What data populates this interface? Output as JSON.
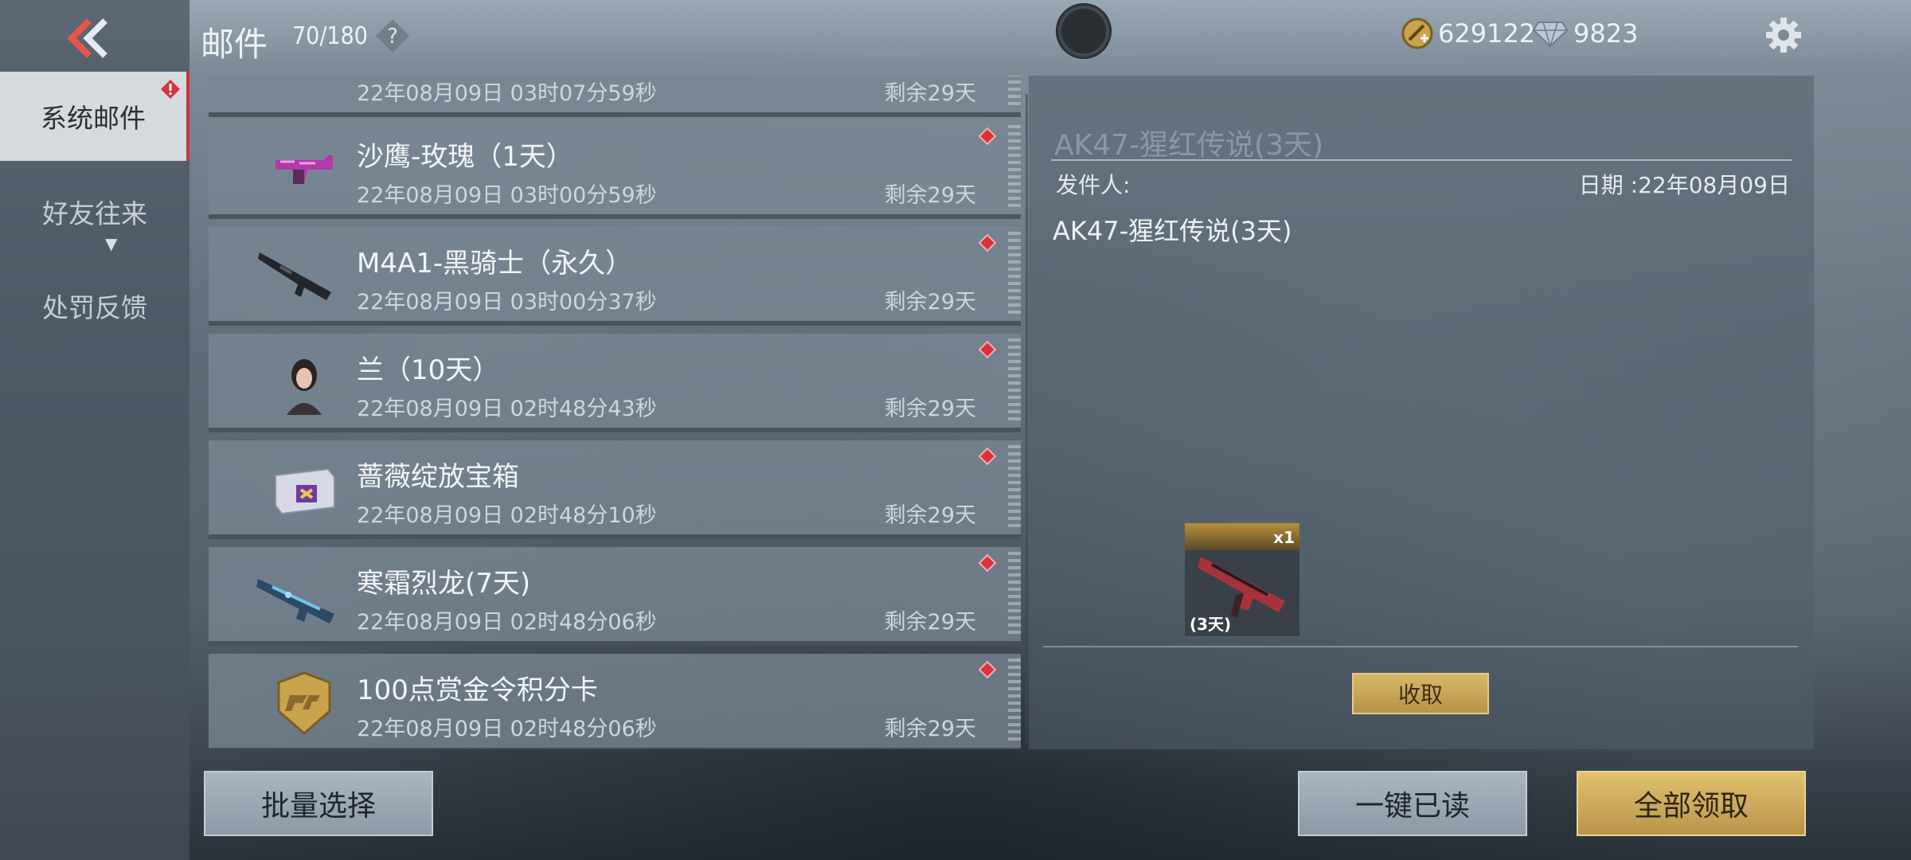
{
  "header": {
    "title": "邮件",
    "mail_count": "70/180",
    "help_symbol": "?",
    "gold": "629122",
    "diamonds": "9823"
  },
  "sidebar": {
    "items": [
      {
        "label": "系统邮件",
        "active": true
      },
      {
        "label": "好友往来",
        "active": false
      },
      {
        "label": "处罚反馈",
        "active": false
      }
    ]
  },
  "mails": [
    {
      "title": "",
      "time": "22年08月09日 03时07分59秒",
      "remaining": "剩余29天",
      "icon": "partial-top"
    },
    {
      "title": "沙鹰-玫瑰（1天）",
      "time": "22年08月09日 03时00分59秒",
      "remaining": "剩余29天",
      "icon": "pistol-icon"
    },
    {
      "title": "M4A1-黑骑士（永久）",
      "time": "22年08月09日 03时00分37秒",
      "remaining": "剩余29天",
      "icon": "rifle-icon"
    },
    {
      "title": "兰（10天）",
      "time": "22年08月09日 02时48分43秒",
      "remaining": "剩余29天",
      "icon": "character-icon"
    },
    {
      "title": "蔷薇绽放宝箱",
      "time": "22年08月09日 02时48分10秒",
      "remaining": "剩余29天",
      "icon": "chest-icon"
    },
    {
      "title": "寒霜烈龙(7天)",
      "time": "22年08月09日 02时48分06秒",
      "remaining": "剩余29天",
      "icon": "smg-icon"
    },
    {
      "title": "100点赏金令积分卡",
      "time": "22年08月09日 02时48分06秒",
      "remaining": "剩余29天",
      "icon": "badge-card-icon"
    }
  ],
  "detail": {
    "title": "AK47-猩红传说(3天)",
    "sender": "发件人:",
    "date": "日期 :22年08月09日",
    "body": "AK47-猩红传说(3天)",
    "reward_qty": "x1",
    "reward_duration": "(3天)",
    "claim_label": "收取"
  },
  "footer": {
    "batch_select": "批量选择",
    "mark_all_read": "一键已读",
    "claim_all": "全部领取"
  },
  "colors": {
    "accent_gold": "#d8b866",
    "unread_red": "#d8323b"
  }
}
